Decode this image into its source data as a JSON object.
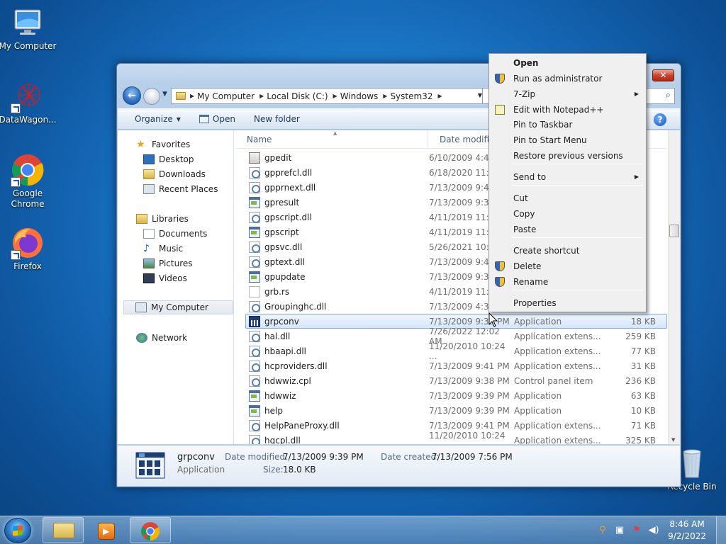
{
  "desktop": {
    "icons": [
      {
        "label": "My Computer",
        "icon": "my-computer-icon"
      },
      {
        "label": "DataWagon...",
        "icon": "datawagon-icon"
      },
      {
        "label": "Google Chrome",
        "icon": "chrome-icon"
      },
      {
        "label": "Firefox",
        "icon": "firefox-icon"
      },
      {
        "label": "Recycle Bin",
        "icon": "recycle-bin-icon"
      }
    ]
  },
  "window": {
    "close_label": "✕",
    "breadcrumb": [
      "My Computer",
      "Local Disk (C:)",
      "Windows",
      "System32"
    ],
    "toolbar": {
      "organize": "Organize",
      "open": "Open",
      "new_folder": "New folder"
    },
    "nav": {
      "favorites": "Favorites",
      "desktop": "Desktop",
      "downloads": "Downloads",
      "recent_places": "Recent Places",
      "libraries": "Libraries",
      "documents": "Documents",
      "music": "Music",
      "pictures": "Pictures",
      "videos": "Videos",
      "my_computer": "My Computer",
      "network": "Network"
    },
    "columns": {
      "name": "Name",
      "date_modified": "Date modified"
    },
    "files": [
      {
        "name": "gpedit",
        "date": "6/10/2009 4:47",
        "type": "",
        "size": "",
        "icon": "msc"
      },
      {
        "name": "gpprefcl.dll",
        "date": "6/18/2020 11:28",
        "type": "",
        "size": "",
        "icon": "dll"
      },
      {
        "name": "gpprnext.dll",
        "date": "7/13/2009 9:41",
        "type": "",
        "size": "",
        "icon": "dll"
      },
      {
        "name": "gpresult",
        "date": "7/13/2009 9:39",
        "type": "",
        "size": "",
        "icon": "app"
      },
      {
        "name": "gpscript.dll",
        "date": "4/11/2019 11:34",
        "type": "",
        "size": "",
        "icon": "dll"
      },
      {
        "name": "gpscript",
        "date": "4/11/2019 11:34",
        "type": "",
        "size": "",
        "icon": "app"
      },
      {
        "name": "gpsvc.dll",
        "date": "5/26/2021 10:46",
        "type": "",
        "size": "",
        "icon": "dll"
      },
      {
        "name": "gptext.dll",
        "date": "7/13/2009 9:41",
        "type": "",
        "size": "",
        "icon": "dll"
      },
      {
        "name": "gpupdate",
        "date": "7/13/2009 9:39",
        "type": "",
        "size": "",
        "icon": "app"
      },
      {
        "name": "grb.rs",
        "date": "4/11/2019 11:22",
        "type": "",
        "size": "",
        "icon": "txt"
      },
      {
        "name": "Groupinghc.dll",
        "date": "7/13/2009 4:32",
        "type": "",
        "size": "",
        "icon": "dll"
      },
      {
        "name": "grpconv",
        "date": "7/13/2009 9:39 PM",
        "type": "Application",
        "size": "18 KB",
        "icon": "sel",
        "selected": true
      },
      {
        "name": "hal.dll",
        "date": "7/26/2022 12:02 AM",
        "type": "Application extens...",
        "size": "259 KB",
        "icon": "dll"
      },
      {
        "name": "hbaapi.dll",
        "date": "11/20/2010 10:24 ...",
        "type": "Application extens...",
        "size": "77 KB",
        "icon": "dll"
      },
      {
        "name": "hcproviders.dll",
        "date": "7/13/2009 9:41 PM",
        "type": "Application extens...",
        "size": "31 KB",
        "icon": "dll"
      },
      {
        "name": "hdwwiz.cpl",
        "date": "7/13/2009 9:38 PM",
        "type": "Control panel item",
        "size": "236 KB",
        "icon": "dll"
      },
      {
        "name": "hdwwiz",
        "date": "7/13/2009 9:39 PM",
        "type": "Application",
        "size": "63 KB",
        "icon": "app"
      },
      {
        "name": "help",
        "date": "7/13/2009 9:39 PM",
        "type": "Application",
        "size": "10 KB",
        "icon": "app"
      },
      {
        "name": "HelpPaneProxy.dll",
        "date": "7/13/2009 9:41 PM",
        "type": "Application extens...",
        "size": "71 KB",
        "icon": "dll"
      },
      {
        "name": "hgcpl.dll",
        "date": "11/20/2010 10:24 ...",
        "type": "Application extens...",
        "size": "325 KB",
        "icon": "dll"
      }
    ],
    "details": {
      "name": "grpconv",
      "type": "Application",
      "date_modified_label": "Date modified:",
      "date_modified": "7/13/2009 9:39 PM",
      "date_created_label": "Date created:",
      "date_created": "7/13/2009 7:56 PM",
      "size_label": "Size:",
      "size": "18.0 KB"
    }
  },
  "context_menu": {
    "items": [
      {
        "label": "Open",
        "bold": true
      },
      {
        "label": "Run as administrator",
        "icon": "shield-icon"
      },
      {
        "label": "7-Zip",
        "submenu": true
      },
      {
        "label": "Edit with Notepad++",
        "icon": "notepadpp-icon"
      },
      {
        "label": "Pin to Taskbar"
      },
      {
        "label": "Pin to Start Menu"
      },
      {
        "label": "Restore previous versions"
      },
      {
        "label": "Send to",
        "submenu": true
      },
      {
        "label": "Cut"
      },
      {
        "label": "Copy"
      },
      {
        "label": "Paste"
      },
      {
        "label": "Create shortcut"
      },
      {
        "label": "Delete",
        "icon": "shield-icon"
      },
      {
        "label": "Rename",
        "icon": "shield-icon"
      },
      {
        "label": "Properties"
      }
    ]
  },
  "taskbar": {
    "time": "8:46 AM",
    "date": "9/2/2022"
  }
}
